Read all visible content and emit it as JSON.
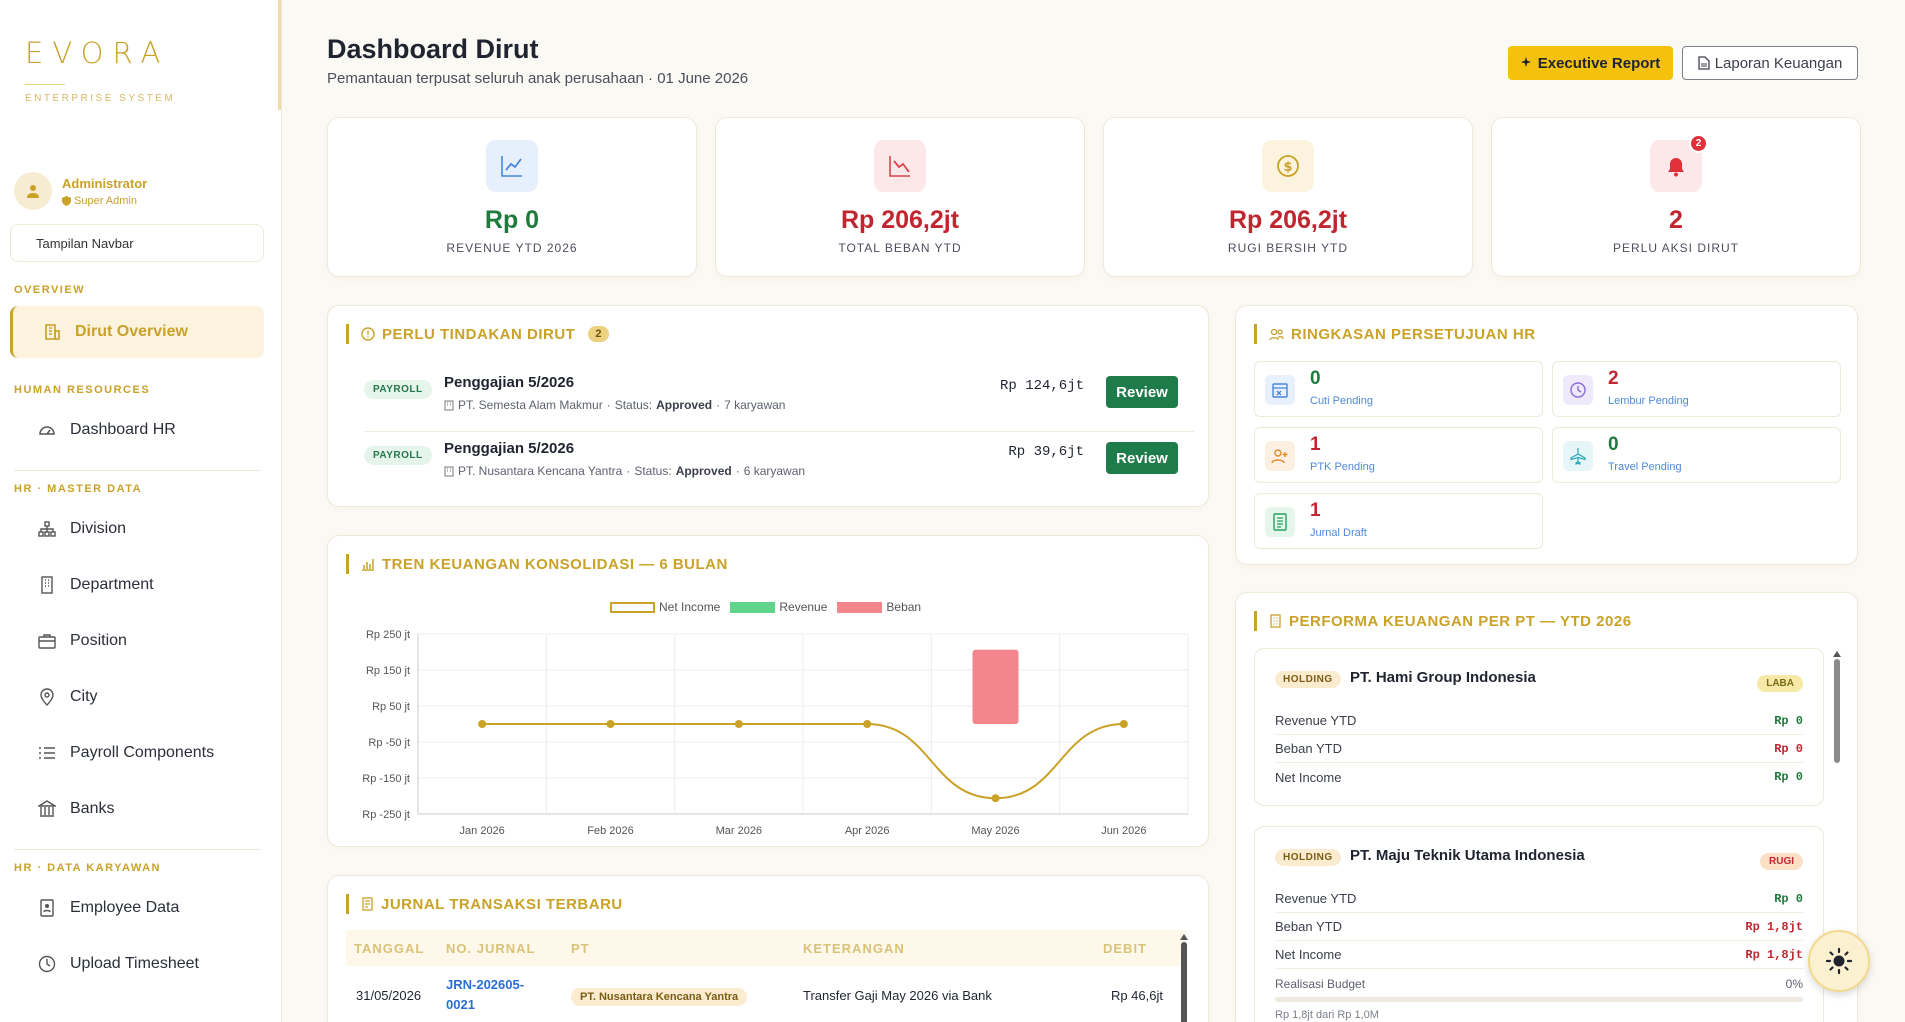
{
  "brand": {
    "name": "EVORA",
    "subtitle": "ENTERPRISE SYSTEM"
  },
  "user": {
    "name": "Administrator",
    "role": "Super Admin"
  },
  "navbar_toggle": "Tampilan Navbar",
  "nav": {
    "overview_title": "OVERVIEW",
    "overview_item": "Dirut Overview",
    "hr_title": "HUMAN RESOURCES",
    "hr_item": "Dashboard HR",
    "master_title": "HR · MASTER DATA",
    "master_items": [
      "Division",
      "Department",
      "Position",
      "City",
      "Payroll Components",
      "Banks"
    ],
    "karyawan_title": "HR · DATA KARYAWAN",
    "karyawan_items": [
      "Employee Data",
      "Upload Timesheet"
    ]
  },
  "header": {
    "title": "Dashboard Dirut",
    "subtitle": "Pemantauan terpusat seluruh anak perusahaan · 01 June 2026",
    "exec_button": "Executive Report",
    "laporan_button": "Laporan Keuangan"
  },
  "kpis": [
    {
      "value": "Rp 0",
      "label": "REVENUE YTD 2026",
      "color": "#1e7b3c"
    },
    {
      "value": "Rp 206,2jt",
      "label": "TOTAL BEBAN YTD",
      "color": "#c0262f"
    },
    {
      "value": "Rp 206,2jt",
      "label": "RUGI BERSIH YTD",
      "color": "#c0262f"
    },
    {
      "value": "2",
      "label": "PERLU AKSI DIRUT",
      "color": "#c0262f",
      "badge": "2"
    }
  ],
  "actions": {
    "title": "PERLU TINDAKAN DIRUT",
    "count": "2",
    "items": [
      {
        "tag": "PAYROLL",
        "title": "Penggajian 5/2026",
        "company": "PT. Semesta Alam Makmur",
        "status_label": "Status:",
        "status": "Approved",
        "employees": "7 karyawan",
        "amount": "Rp 124,6jt",
        "button": "Review"
      },
      {
        "tag": "PAYROLL",
        "title": "Penggajian 5/2026",
        "company": "PT. Nusantara Kencana Yantra",
        "status_label": "Status:",
        "status": "Approved",
        "employees": "6 karyawan",
        "amount": "Rp 39,6jt",
        "button": "Review"
      }
    ]
  },
  "hr_summary": {
    "title": "RINGKASAN PERSETUJUAN HR",
    "tiles": [
      {
        "value": "0",
        "label": "Cuti Pending",
        "color": "#1e7b3c",
        "icon": "calendar-x-icon",
        "bg": "#e8f0fb"
      },
      {
        "value": "2",
        "label": "Lembur Pending",
        "color": "#c0262f",
        "icon": "clock-icon",
        "bg": "#efeafb"
      },
      {
        "value": "1",
        "label": "PTK Pending",
        "color": "#c0262f",
        "icon": "user-plus-icon",
        "bg": "#fdf0e3"
      },
      {
        "value": "0",
        "label": "Travel Pending",
        "color": "#1e7b3c",
        "icon": "plane-icon",
        "bg": "#e6f6f8"
      },
      {
        "value": "1",
        "label": "Jurnal Draft",
        "color": "#c0262f",
        "icon": "journal-icon",
        "bg": "#e6f6ec"
      }
    ]
  },
  "chart_data": {
    "type": "line",
    "title": "TREN KEUANGAN KONSOLIDASI — 6 BULAN",
    "categories": [
      "Jan 2026",
      "Feb 2026",
      "Mar 2026",
      "Apr 2026",
      "May 2026",
      "Jun 2026"
    ],
    "series": [
      {
        "name": "Net Income",
        "type": "line",
        "color": "#c9a227",
        "values": [
          0,
          0,
          0,
          0,
          -206.2,
          0
        ]
      },
      {
        "name": "Revenue",
        "type": "bar",
        "color": "#5fd48a",
        "values": [
          0,
          0,
          0,
          0,
          0,
          0
        ]
      },
      {
        "name": "Beban",
        "type": "bar",
        "color": "#f2868c",
        "values": [
          0,
          0,
          0,
          0,
          206.2,
          0
        ]
      }
    ],
    "y_ticks": [
      "Rp 250 jt",
      "Rp 150 jt",
      "Rp 50 jt",
      "Rp -50 jt",
      "Rp -150 jt",
      "Rp -250 jt"
    ],
    "ylim": [
      -250,
      250
    ],
    "grid": true,
    "legend": "top-center"
  },
  "performance": {
    "title": "PERFORMA KEUANGAN PER PT — YTD 2026",
    "companies": [
      {
        "tag": "HOLDING",
        "name": "PT. Hami Group Indonesia",
        "status": "LABA",
        "status_color": "#7a6a10",
        "status_bg": "#f6e9a8",
        "rows": [
          [
            "Revenue YTD",
            "Rp 0",
            "#1e7b3c"
          ],
          [
            "Beban YTD",
            "Rp 0",
            "#c0262f"
          ],
          [
            "Net Income",
            "Rp 0",
            "#1e7b3c"
          ]
        ]
      },
      {
        "tag": "HOLDING",
        "name": "PT. Maju Teknik Utama Indonesia",
        "status": "RUGI",
        "status_color": "#c0262f",
        "status_bg": "#fbe0c5",
        "rows": [
          [
            "Revenue YTD",
            "Rp 0",
            "#1e7b3c"
          ],
          [
            "Beban YTD",
            "Rp 1,8jt",
            "#c0262f"
          ],
          [
            "Net Income",
            "Rp 1,8jt",
            "#c0262f"
          ]
        ],
        "budget_label": "Realisasi Budget",
        "budget_pct": "0%",
        "budget_note": "Rp 1,8jt dari Rp 1,0M"
      }
    ]
  },
  "journal": {
    "title": "JURNAL TRANSAKSI TERBARU",
    "columns": [
      "TANGGAL",
      "NO. JURNAL",
      "PT",
      "KETERANGAN",
      "DEBIT"
    ],
    "rows": [
      {
        "date": "31/05/2026",
        "no": "JRN-202605-0021",
        "pt": "PT. Nusantara Kencana Yantra",
        "desc": "Transfer Gaji May 2026 via Bank",
        "debit": "Rp 46,6jt"
      }
    ]
  }
}
